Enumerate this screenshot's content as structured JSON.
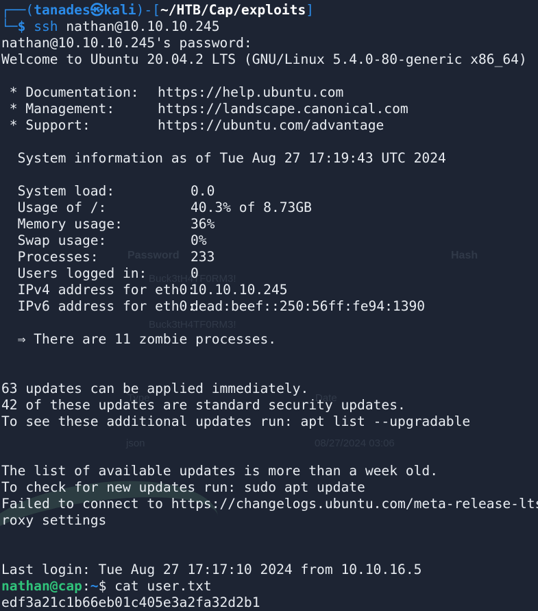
{
  "prompt": {
    "frame_open": "┌──(",
    "user_host": "tanades㉿kali",
    "frame_mid": ")-[",
    "path": "~/HTB/Cap/exploits",
    "frame_close": "]",
    "corner": "└─",
    "symbol": "$",
    "command_name": "ssh",
    "command_args": " nathan@10.10.10.245"
  },
  "password_prompt": "nathan@10.10.10.245's password:",
  "welcome": "Welcome to Ubuntu 20.04.2 LTS (GNU/Linux 5.4.0-80-generic x86_64)",
  "links": [
    {
      "key": " * Documentation:",
      "url": "https://help.ubuntu.com"
    },
    {
      "key": " * Management:",
      "url": "https://landscape.canonical.com"
    },
    {
      "key": " * Support:",
      "url": "https://ubuntu.com/advantage"
    }
  ],
  "sysinfo_header": "  System information as of Tue Aug 27 17:19:43 UTC 2024",
  "sysinfo": [
    {
      "key": "  System load:",
      "value": "0.0"
    },
    {
      "key": "  Usage of /:",
      "value": "40.3% of 8.73GB"
    },
    {
      "key": "  Memory usage:",
      "value": "36%"
    },
    {
      "key": "  Swap usage:",
      "value": "0%"
    },
    {
      "key": "  Processes:",
      "value": "233"
    },
    {
      "key": "  Users logged in:",
      "value": "0"
    },
    {
      "key": "  IPv4 address for eth0:",
      "value": "10.10.10.245"
    },
    {
      "key": "  IPv6 address for eth0:",
      "value": "dead:beef::250:56ff:fe94:1390"
    }
  ],
  "zombie": "  ⇒ There are 11 zombie processes.",
  "updates": [
    "63 updates can be applied immediately.",
    "42 of these updates are standard security updates.",
    "To see these additional updates run: apt list --upgradable"
  ],
  "release": [
    "The list of available updates is more than a week old.",
    "To check for new updates run: sudo apt update",
    "Failed to connect to https://changelogs.ubuntu.com/meta-release-lts",
    "roxy settings"
  ],
  "last_login": "Last login: Tue Aug 27 17:17:10 2024 from 10.10.16.5",
  "nathan_prompt": {
    "user_host": "nathan@cap",
    "colon": ":",
    "tilde": "~",
    "symbol": "$",
    "command": " cat user.txt"
  },
  "flag": "edf3a21c1b66eb01c405e3a2fa32d2b1",
  "background_ghost": {
    "password_header": "Password",
    "hash_header": "Hash",
    "password_value_1": "Buck3tH4TF0RM3!",
    "password_value_2": "Buck3tH4TF0RM3!",
    "type_header": "Type",
    "date_header": "Date",
    "type_value": "json",
    "date_value": "08/27/2024 03:06"
  },
  "colors": {
    "background": "#1d2433",
    "prompt_blue": "#2b8be8",
    "user_green": "#30c27a",
    "text": "#e8ecf1"
  }
}
